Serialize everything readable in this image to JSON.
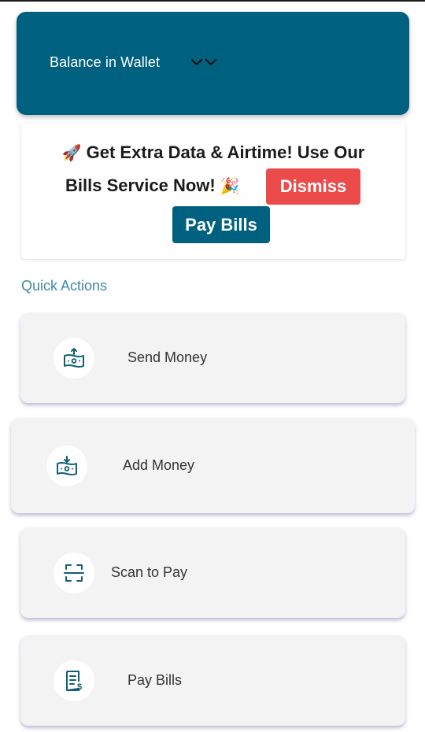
{
  "wallet": {
    "label": "Balance in Wallet",
    "toggle_icon": "double-chevron-down-icon"
  },
  "promo": {
    "line1_emoji": "🚀",
    "line1_text": "Get Extra Data & Airtime! Use Our",
    "line2_text": "Bills Service Now!",
    "line2_emoji": "🎉",
    "dismiss_label": "Dismiss",
    "pay_bills_label": "Pay Bills"
  },
  "quick_actions": {
    "title": "Quick Actions",
    "items": [
      {
        "label": "Send Money",
        "icon": "send-money-icon"
      },
      {
        "label": "Add Money",
        "icon": "add-money-icon"
      },
      {
        "label": "Scan to Pay",
        "icon": "scan-icon"
      },
      {
        "label": "Pay Bills",
        "icon": "bill-icon"
      }
    ]
  },
  "colors": {
    "primary": "#00607f",
    "danger": "#ec4b4b",
    "section_title": "#3d8aa6",
    "card_bg": "#f3f3f3"
  }
}
